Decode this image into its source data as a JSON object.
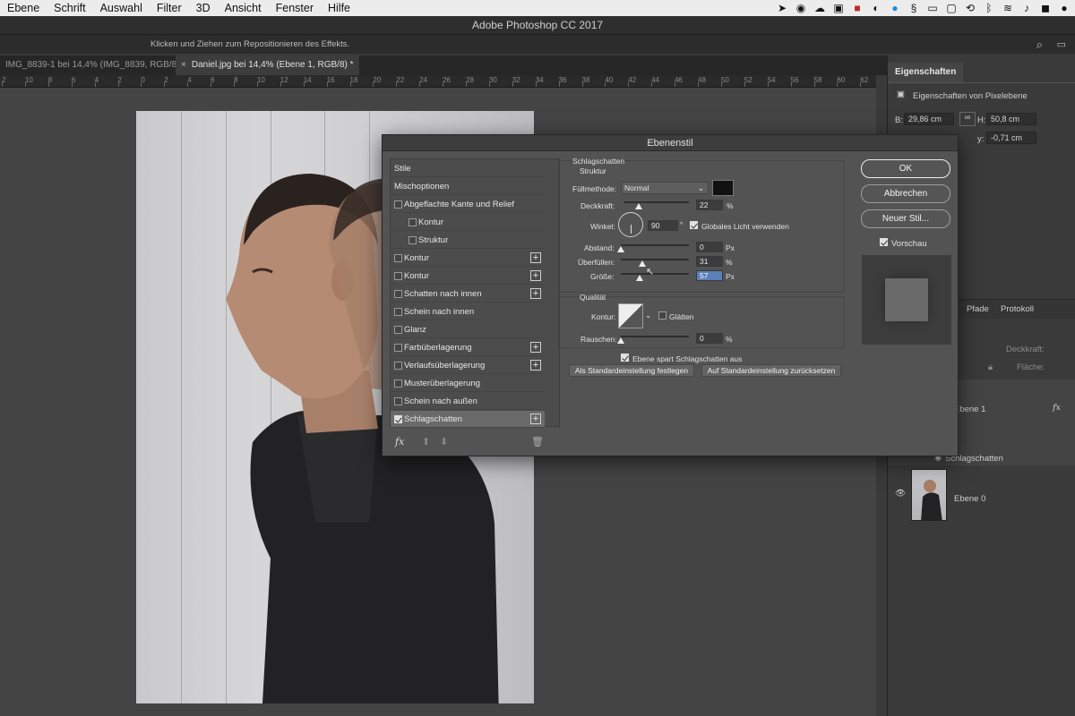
{
  "menubar": {
    "items": [
      "Ebene",
      "Schrift",
      "Auswahl",
      "Filter",
      "3D",
      "Ansicht",
      "Fenster",
      "Hilfe"
    ]
  },
  "app": {
    "title": "Adobe Photoshop CC 2017",
    "hint": "Klicken und Ziehen zum Repositionieren des Effekts."
  },
  "tabs": [
    {
      "label": "IMG_8839-1 bei 14,4% (IMG_8839, RGB/8) *"
    },
    {
      "label": "Daniel.jpg bei 14,4% (Ebene 1, RGB/8) *"
    }
  ],
  "ruler": {
    "labels": [
      "2",
      "10",
      "8",
      "6",
      "4",
      "2",
      "0",
      "2",
      "4",
      "6",
      "8",
      "10",
      "12",
      "14",
      "16",
      "18",
      "20",
      "22",
      "24",
      "26",
      "28",
      "30",
      "32",
      "34",
      "36",
      "38",
      "40",
      "42",
      "44",
      "46",
      "48",
      "50",
      "52",
      "54",
      "56",
      "58",
      "60",
      "62"
    ]
  },
  "properties": {
    "tab": "Eigenschaften",
    "subtitle": "Eigenschaften von Pixelebene",
    "w_label": "B:",
    "w_value": "29,86 cm",
    "h_label": "H:",
    "h_value": "50,8 cm",
    "y_label": "y:",
    "y_value": "-0,71 cm"
  },
  "layers": {
    "tabs": [
      "Pfade",
      "Protokoll"
    ],
    "opacity_label": "Deckkraft:",
    "fill_label": "Fläche:",
    "layer1": "Ebene 1",
    "effect": "Schlagschatten",
    "layer0": "Ebene 0",
    "fx": "fx"
  },
  "dialog": {
    "title": "Ebenenstil",
    "styles": [
      {
        "label": "Stile",
        "checkbox": false,
        "plus": false,
        "indent": 0,
        "selected": false
      },
      {
        "label": "Mischoptionen",
        "checkbox": false,
        "plus": false,
        "indent": 0,
        "selected": false
      },
      {
        "label": "Abgeflachte Kante und Relief",
        "checkbox": true,
        "checked": false,
        "plus": false,
        "indent": 0
      },
      {
        "label": "Kontur",
        "checkbox": true,
        "checked": false,
        "plus": false,
        "indent": 1
      },
      {
        "label": "Struktur",
        "checkbox": true,
        "checked": false,
        "plus": false,
        "indent": 1
      },
      {
        "label": "Kontur",
        "checkbox": true,
        "checked": false,
        "plus": true,
        "indent": 0
      },
      {
        "label": "Kontur",
        "checkbox": true,
        "checked": false,
        "plus": true,
        "indent": 0
      },
      {
        "label": "Schatten nach innen",
        "checkbox": true,
        "checked": false,
        "plus": true,
        "indent": 0
      },
      {
        "label": "Schein nach innen",
        "checkbox": true,
        "checked": false,
        "plus": false,
        "indent": 0
      },
      {
        "label": "Glanz",
        "checkbox": true,
        "checked": false,
        "plus": false,
        "indent": 0
      },
      {
        "label": "Farbüberlagerung",
        "checkbox": true,
        "checked": false,
        "plus": true,
        "indent": 0
      },
      {
        "label": "Verlaufsüberlagerung",
        "checkbox": true,
        "checked": false,
        "plus": true,
        "indent": 0
      },
      {
        "label": "Musterüberlagerung",
        "checkbox": true,
        "checked": false,
        "plus": false,
        "indent": 0
      },
      {
        "label": "Schein nach außen",
        "checkbox": true,
        "checked": false,
        "plus": false,
        "indent": 0
      },
      {
        "label": "Schlagschatten",
        "checkbox": true,
        "checked": true,
        "plus": true,
        "indent": 0,
        "selected": true
      }
    ],
    "footer": {
      "fx": "fx"
    },
    "section_title": "Schlagschatten",
    "structure_title": "Struktur",
    "blend_label": "Füllmethode:",
    "blend_value": "Normal",
    "shadow_color": "#111111",
    "opacity_label": "Deckkraft:",
    "opacity_value": "22",
    "opacity_pct": 22,
    "angle_label": "Winkel:",
    "angle_value": "90",
    "angle_unit": "°",
    "global_light": "Globales Licht verwenden",
    "distance_label": "Abstand:",
    "distance_value": "0",
    "distance_pct": 0,
    "spread_label": "Überfüllen:",
    "spread_value": "31",
    "spread_pct": 31,
    "size_label": "Größe:",
    "size_value": "57",
    "size_pct": 28,
    "unit_px": "Px",
    "unit_pct": "%",
    "quality_title": "Qualität",
    "contour_label": "Kontur:",
    "antialias": "Glätten",
    "noise_label": "Rauschen:",
    "noise_value": "0",
    "noise_pct": 0,
    "knockout": "Ebene spart Schlagschatten aus",
    "make_default": "Als Standardeinstellung festlegen",
    "reset_default": "Auf Standardeinstellung zurücksetzen",
    "ok": "OK",
    "cancel": "Abbrechen",
    "new_style": "Neuer Stil...",
    "preview": "Vorschau"
  }
}
